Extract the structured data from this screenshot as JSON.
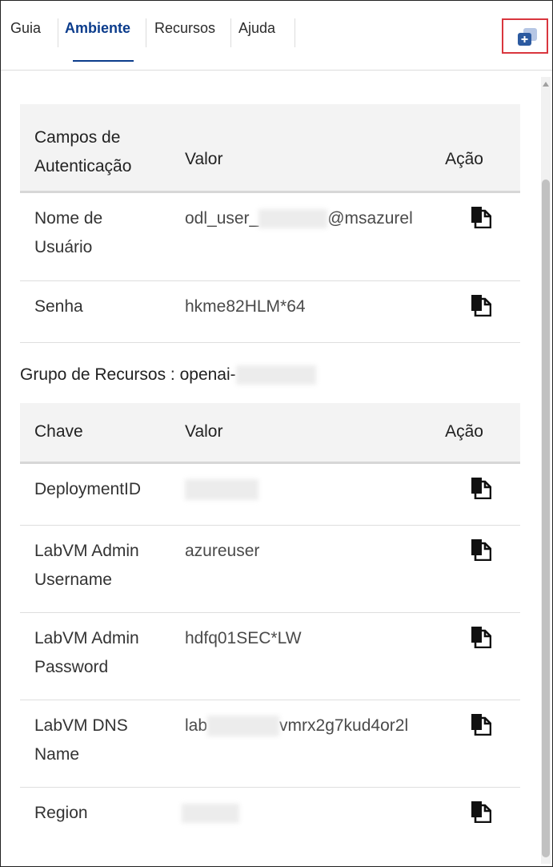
{
  "tabs": [
    {
      "label": "Guia"
    },
    {
      "label": "Ambiente"
    },
    {
      "label": "Recursos"
    },
    {
      "label": "Ajuda"
    }
  ],
  "auth_table": {
    "headers": {
      "field": "Campos de Autenticação",
      "value": "Valor",
      "action": "Ação"
    },
    "rows": [
      {
        "key": "Nome de Usuário",
        "value_prefix": "odl_user_",
        "value_suffix": "@msazurel"
      },
      {
        "key": "Senha",
        "value": "hkme82HLM*64"
      }
    ]
  },
  "resource_group": {
    "label": "Grupo de Recursos : openai-"
  },
  "resource_table": {
    "headers": {
      "key": "Chave",
      "value": "Valor",
      "action": "Ação"
    },
    "rows": [
      {
        "key": "DeploymentID",
        "value": ""
      },
      {
        "key": "LabVM Admin Username",
        "value": "azureuser"
      },
      {
        "key": "LabVM Admin Password",
        "value": "hdfq01SEC*LW"
      },
      {
        "key": "LabVM DNS Name",
        "value_prefix": "lab",
        "value_suffix": "vmrx2g7kud4or2l"
      },
      {
        "key": "Region",
        "value": ""
      }
    ]
  },
  "icons": {
    "copy": "copy-icon",
    "extension": "open-extension-icon",
    "accent": "#0b3c8c",
    "highlight": "#d9363e"
  }
}
